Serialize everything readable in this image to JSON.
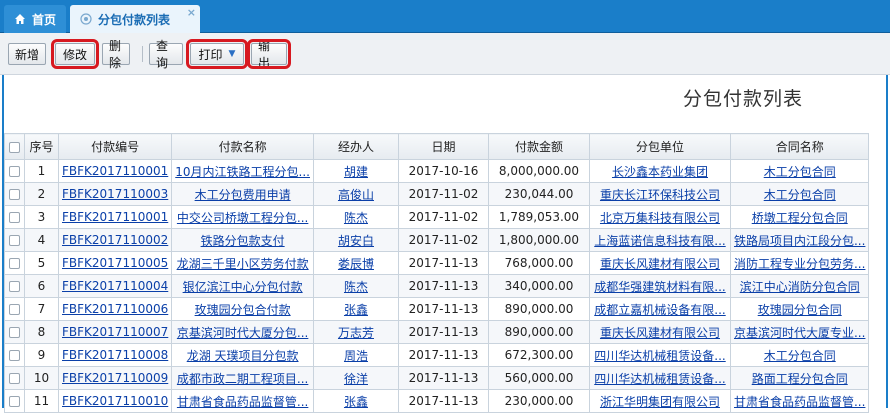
{
  "tabs": [
    {
      "label": "首页",
      "icon": "home-icon"
    },
    {
      "label": "分包付款列表",
      "icon": "page-icon",
      "close": "×"
    }
  ],
  "toolbar": {
    "add": "新增",
    "edit": "修改",
    "delete": "删除",
    "query": "查询",
    "print": "打印",
    "export": "输出"
  },
  "colors": {
    "tabbar": "#1a7ec9",
    "highlight": "#d71920",
    "link": "#0a3fa8"
  },
  "page_title": "分包付款列表",
  "table": {
    "headers": [
      "序号",
      "付款编号",
      "付款名称",
      "经办人",
      "日期",
      "付款金额",
      "分包单位",
      "合同名称"
    ],
    "rows": [
      [
        "1",
        "FBFK2017110001",
        "10月内江铁路工程分包...",
        "胡建",
        "2017-10-16",
        "8,000,000.00",
        "长沙鑫本药业集团",
        "木工分包合同"
      ],
      [
        "2",
        "FBFK2017110003",
        "木工分包费用申请",
        "高俊山",
        "2017-11-02",
        "230,044.00",
        "重庆长江环保科技公司",
        "木工分包合同"
      ],
      [
        "3",
        "FBFK2017110001",
        "中交公司桥墩工程分包...",
        "陈杰",
        "2017-11-02",
        "1,789,053.00",
        "北京万集科技有限公司",
        "桥墩工程分包合同"
      ],
      [
        "4",
        "FBFK2017110002",
        "铁路分包款支付",
        "胡安白",
        "2017-11-02",
        "1,800,000.00",
        "上海蓝诺信息科技有限...",
        "铁路局项目内江段分包..."
      ],
      [
        "5",
        "FBFK2017110005",
        "龙湖三千里小区劳务付款",
        "娄辰博",
        "2017-11-13",
        "768,000.00",
        "重庆长风建材有限公司",
        "消防工程专业分包劳务..."
      ],
      [
        "6",
        "FBFK2017110004",
        "银亿滨江中心分包付款",
        "陈杰",
        "2017-11-13",
        "340,000.00",
        "成都华强建筑材料有限...",
        "滨江中心消防分包合同"
      ],
      [
        "7",
        "FBFK2017110006",
        "玫瑰园分包合付款",
        "张鑫",
        "2017-11-13",
        "890,000.00",
        "成都立嘉机械设备有限...",
        "玫瑰园分包合同"
      ],
      [
        "8",
        "FBFK2017110007",
        "京基滨河时代大厦分包...",
        "万志芳",
        "2017-11-13",
        "890,000.00",
        "重庆长风建材有限公司",
        "京基滨河时代大厦专业..."
      ],
      [
        "9",
        "FBFK2017110008",
        "龙湖 天璞项目分包款",
        "周浩",
        "2017-11-13",
        "672,300.00",
        "四川华达机械租赁设备...",
        "木工分包合同"
      ],
      [
        "10",
        "FBFK2017110009",
        "成都市政二期工程项目...",
        "徐洋",
        "2017-11-13",
        "560,000.00",
        "四川华达机械租赁设备...",
        "路面工程分包合同"
      ],
      [
        "11",
        "FBFK2017110010",
        "甘肃省食品药品监督管...",
        "张鑫",
        "2017-11-13",
        "230,000.00",
        "浙江华明集团有限公司",
        "甘肃省食品药品监督管..."
      ]
    ]
  }
}
